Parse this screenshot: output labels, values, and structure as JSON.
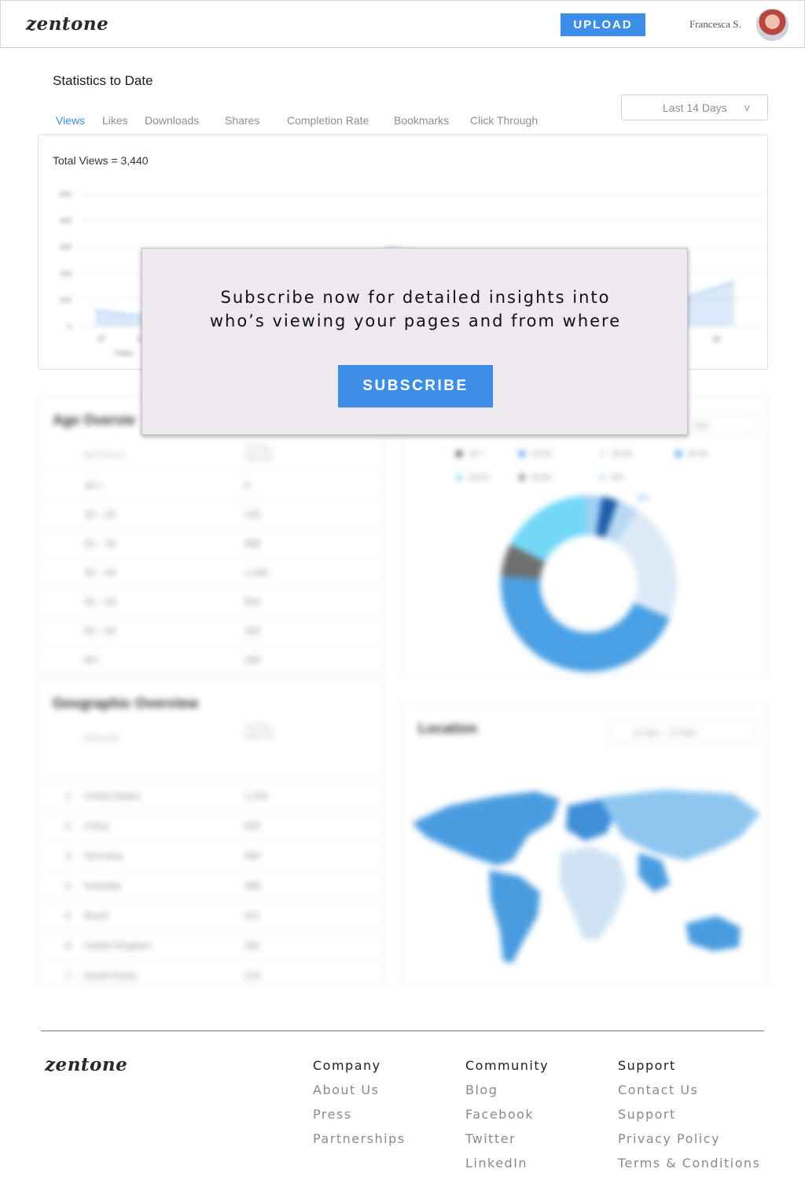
{
  "header": {
    "logo": "zentone",
    "upload_label": "UPLOAD",
    "user_name": "Francesca S."
  },
  "stats": {
    "title": "Statistics to Date",
    "tabs": [
      "Views",
      "Likes",
      "Downloads",
      "Shares",
      "Completion Rate",
      "Bookmarks",
      "Click Through"
    ],
    "active_tab": "Views",
    "range_label": "Last 14 Days",
    "range_chevron": "v",
    "total_label": "Total Views = 3,440"
  },
  "chart_data": {
    "type": "area",
    "title": "",
    "xlabel": "",
    "ylabel": "",
    "ylim": [
      0,
      500
    ],
    "y_ticks": [
      "500",
      "400",
      "300",
      "200",
      "100",
      "0"
    ],
    "x_ticks_visible": [
      "27",
      "2",
      "16"
    ],
    "x_sublabel_visible": "Febru",
    "grid": true,
    "series": [
      {
        "values": [
          60,
          40,
          70,
          140,
          120,
          180,
          300,
          260,
          220,
          230,
          180,
          130,
          110,
          170
        ]
      }
    ],
    "colors": {
      "fill": "#cfe3f7",
      "line": "#a9cdf1"
    }
  },
  "modal": {
    "line1": "Subscribe now for detailed insights into",
    "line2": "who’s viewing your pages and from where",
    "button_label": "SUBSCRIBE"
  },
  "age_panel": {
    "title": "Age Overvie",
    "col1": "METRICS",
    "col2": "TOTAL VALUE",
    "rows": [
      {
        "label": "18 <",
        "value": "8"
      },
      {
        "label": "18 – 24",
        "value": "103"
      },
      {
        "label": "25 – 34",
        "value": "688"
      },
      {
        "label": "35 – 44",
        "value": "1,445"
      },
      {
        "label": "45 – 54",
        "value": "854"
      },
      {
        "label": "55 – 64",
        "value": "344"
      },
      {
        "label": "65+",
        "value": "208"
      }
    ]
  },
  "donut_panel": {
    "pill": "Dec",
    "legend": [
      "18 <",
      "18-24",
      "25-34",
      "35-44",
      "45-54",
      "55-64",
      "65+"
    ],
    "legend_colors": [
      "#333333",
      "#3d8ee8",
      "#d9e8f8",
      "#3d8ee8",
      "#7fd6f2",
      "#777777",
      "#bfe0f7"
    ],
    "top_label": "3%",
    "values": [
      3,
      4,
      22,
      45,
      6,
      17,
      3
    ],
    "slice_colors": [
      "#1c5da8",
      "#b7d8f5",
      "#dde9f6",
      "#4aa0e4",
      "#6f6f6f",
      "#72d8f6",
      "#9fd0f4"
    ]
  },
  "geo_panel": {
    "title": "Geographic Overview",
    "col1": "REGION",
    "col2": "TOTAL VALUE",
    "rows": [
      {
        "rank": "1.",
        "label": "United States",
        "value": "1,203"
      },
      {
        "rank": "2.",
        "label": "China",
        "value": "830"
      },
      {
        "rank": "3.",
        "label": "Germany",
        "value": "560"
      },
      {
        "rank": "4.",
        "label": "Australia",
        "value": "489"
      },
      {
        "rank": "5.",
        "label": "Brazil",
        "value": "421"
      },
      {
        "rank": "6.",
        "label": "United Kingdom",
        "value": "291"
      },
      {
        "rank": "7.",
        "label": "South Korea",
        "value": "123"
      }
    ]
  },
  "location_panel": {
    "title": "Location",
    "pill": "11 Nov – 10 Dec"
  },
  "footer": {
    "logo": "zentone",
    "columns": [
      {
        "heading": "Company",
        "links": [
          "About Us",
          "Press",
          "Partnerships"
        ]
      },
      {
        "heading": "Community",
        "links": [
          "Blog",
          "Facebook",
          "Twitter",
          "LinkedIn"
        ]
      },
      {
        "heading": "Support",
        "links": [
          "Contact Us",
          "Support",
          "Privacy Policy",
          "Terms & Conditions"
        ]
      }
    ]
  }
}
